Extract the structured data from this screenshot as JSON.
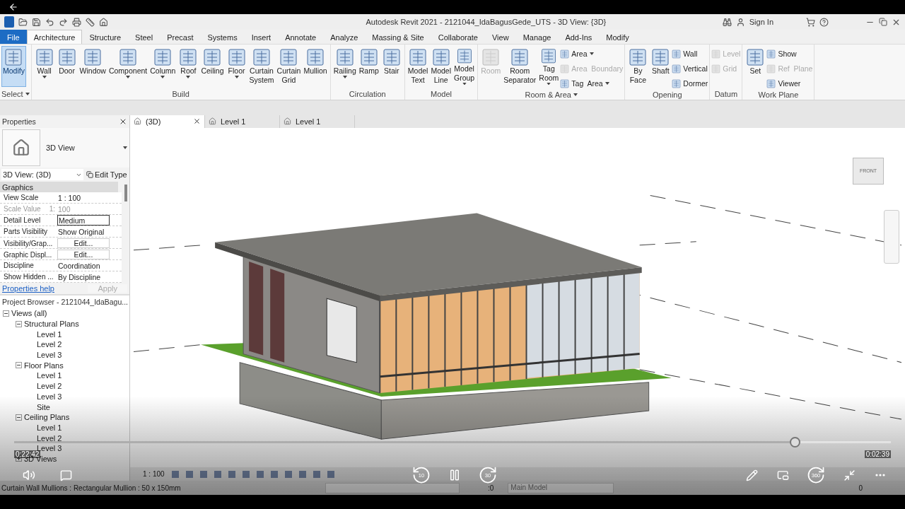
{
  "titlebar": {
    "title": "Autodesk Revit 2021 - 2121044_IdaBagusGede_UTS - 3D View: {3D}",
    "sign_in": "Sign In"
  },
  "menu_tabs": [
    {
      "label": "File",
      "kind": "file",
      "selected": false
    },
    {
      "label": "Architecture",
      "kind": "tab",
      "selected": true
    },
    {
      "label": "Structure",
      "kind": "tab",
      "selected": false
    },
    {
      "label": "Steel",
      "kind": "tab",
      "selected": false
    },
    {
      "label": "Precast",
      "kind": "tab",
      "selected": false
    },
    {
      "label": "Systems",
      "kind": "tab",
      "selected": false
    },
    {
      "label": "Insert",
      "kind": "tab",
      "selected": false
    },
    {
      "label": "Annotate",
      "kind": "tab",
      "selected": false
    },
    {
      "label": "Analyze",
      "kind": "tab",
      "selected": false
    },
    {
      "label": "Massing & Site",
      "kind": "tab",
      "selected": false
    },
    {
      "label": "Collaborate",
      "kind": "tab",
      "selected": false
    },
    {
      "label": "View",
      "kind": "tab",
      "selected": false
    },
    {
      "label": "Manage",
      "kind": "tab",
      "selected": false
    },
    {
      "label": "Add-Ins",
      "kind": "tab",
      "selected": false
    },
    {
      "label": "Modify",
      "kind": "tab",
      "selected": false
    }
  ],
  "ribbon": [
    {
      "label": "Select",
      "menu": true,
      "tools": [
        {
          "kind": "large",
          "label": "Modify",
          "active": true,
          "disabled": false,
          "dropdown": false
        }
      ]
    },
    {
      "label": "Build",
      "menu": false,
      "tools": [
        {
          "kind": "large",
          "label": "Wall",
          "active": false,
          "disabled": false,
          "dropdown": true
        },
        {
          "kind": "large",
          "label": "Door",
          "active": false,
          "disabled": false,
          "dropdown": false
        },
        {
          "kind": "large",
          "label": "Window",
          "active": false,
          "disabled": false,
          "dropdown": false
        },
        {
          "kind": "large",
          "label": "Component",
          "active": false,
          "disabled": false,
          "dropdown": true
        },
        {
          "kind": "large",
          "label": "Column",
          "active": false,
          "disabled": false,
          "dropdown": true
        },
        {
          "kind": "large",
          "label": "Roof",
          "active": false,
          "disabled": false,
          "dropdown": true
        },
        {
          "kind": "large",
          "label": "Ceiling",
          "active": false,
          "disabled": false,
          "dropdown": false
        },
        {
          "kind": "large",
          "label": "Floor",
          "active": false,
          "disabled": false,
          "dropdown": true
        },
        {
          "kind": "large",
          "label": "Curtain System",
          "active": false,
          "disabled": false,
          "dropdown": false
        },
        {
          "kind": "large",
          "label": "Curtain Grid",
          "active": false,
          "disabled": false,
          "dropdown": false
        },
        {
          "kind": "large",
          "label": "Mullion",
          "active": false,
          "disabled": false,
          "dropdown": false
        }
      ]
    },
    {
      "label": "Circulation",
      "menu": false,
      "tools": [
        {
          "kind": "large",
          "label": "Railing",
          "active": false,
          "disabled": false,
          "dropdown": true
        },
        {
          "kind": "large",
          "label": "Ramp",
          "active": false,
          "disabled": false,
          "dropdown": false
        },
        {
          "kind": "large",
          "label": "Stair",
          "active": false,
          "disabled": false,
          "dropdown": false
        }
      ]
    },
    {
      "label": "Model",
      "menu": false,
      "tools": [
        {
          "kind": "large",
          "label": "Model Text",
          "active": false,
          "disabled": false,
          "dropdown": false
        },
        {
          "kind": "large",
          "label": "Model Line",
          "active": false,
          "disabled": false,
          "dropdown": false
        },
        {
          "kind": "large",
          "label": "Model Group",
          "active": false,
          "disabled": false,
          "dropdown": true
        }
      ]
    },
    {
      "label": "Room & Area",
      "menu": true,
      "tools": [
        {
          "kind": "large",
          "label": "Room",
          "active": false,
          "disabled": true,
          "dropdown": false
        },
        {
          "kind": "large",
          "label": "Room Separator",
          "active": false,
          "disabled": false,
          "dropdown": false
        },
        {
          "kind": "large",
          "label": "Tag Room",
          "active": false,
          "disabled": false,
          "dropdown": true
        },
        {
          "kind": "small",
          "label": "Area",
          "active": false,
          "disabled": false,
          "dropdown": true
        },
        {
          "kind": "small",
          "label": "Area  Boundary",
          "active": false,
          "disabled": true,
          "dropdown": false
        },
        {
          "kind": "small",
          "label": "Tag  Area",
          "active": false,
          "disabled": false,
          "dropdown": true
        }
      ]
    },
    {
      "label": "Opening",
      "menu": false,
      "tools": [
        {
          "kind": "large",
          "label": "By Face",
          "active": false,
          "disabled": false,
          "dropdown": false
        },
        {
          "kind": "large",
          "label": "Shaft",
          "active": false,
          "disabled": false,
          "dropdown": false
        },
        {
          "kind": "small",
          "label": "Wall",
          "active": false,
          "disabled": false,
          "dropdown": false
        },
        {
          "kind": "small",
          "label": "Vertical",
          "active": false,
          "disabled": false,
          "dropdown": false
        },
        {
          "kind": "small",
          "label": "Dormer",
          "active": false,
          "disabled": false,
          "dropdown": false
        }
      ]
    },
    {
      "label": "Datum",
      "menu": false,
      "tools": [
        {
          "kind": "small",
          "label": "Level",
          "active": false,
          "disabled": true,
          "dropdown": false
        },
        {
          "kind": "small",
          "label": "Grid",
          "active": false,
          "disabled": true,
          "dropdown": false
        }
      ]
    },
    {
      "label": "Work Plane",
      "menu": false,
      "tools": [
        {
          "kind": "large",
          "label": "Set",
          "active": false,
          "disabled": false,
          "dropdown": false
        },
        {
          "kind": "small",
          "label": "Show",
          "active": false,
          "disabled": false,
          "dropdown": false
        },
        {
          "kind": "small",
          "label": "Ref  Plane",
          "active": false,
          "disabled": true,
          "dropdown": false
        },
        {
          "kind": "small",
          "label": "Viewer",
          "active": false,
          "disabled": false,
          "dropdown": false
        }
      ]
    }
  ],
  "properties": {
    "title": "Properties",
    "type_name": "3D View",
    "selector": "3D View: (3D)",
    "edit_type": "Edit Type",
    "section": "Graphics",
    "rows": [
      {
        "label": "View Scale",
        "value": "1 : 100",
        "kind": "text",
        "disabled": false
      },
      {
        "label": "Scale Value",
        "prefix": "1:",
        "value": "100",
        "kind": "text",
        "disabled": true
      },
      {
        "label": "Detail Level",
        "value": "Medium",
        "kind": "field",
        "disabled": false
      },
      {
        "label": "Parts Visibility",
        "value": "Show Original",
        "kind": "text",
        "disabled": false
      },
      {
        "label": "Visibility/Grap...",
        "value": "Edit...",
        "kind": "button",
        "disabled": false
      },
      {
        "label": "Graphic Displ...",
        "value": "Edit...",
        "kind": "button",
        "disabled": false
      },
      {
        "label": "Discipline",
        "value": "Coordination",
        "kind": "text",
        "disabled": false
      },
      {
        "label": "Show Hidden ...",
        "value": "By Discipline",
        "kind": "text",
        "disabled": false
      }
    ],
    "help": "Properties help",
    "apply": "Apply"
  },
  "project_browser": {
    "title": "Project Browser - 2121044_IdaBagu...",
    "tree": [
      {
        "label": "Views (all)",
        "expanded": true,
        "children": [
          {
            "label": "Structural Plans",
            "expanded": true,
            "children": [
              {
                "label": "Level 1"
              },
              {
                "label": "Level 2"
              },
              {
                "label": "Level 3"
              }
            ]
          },
          {
            "label": "Floor Plans",
            "expanded": true,
            "children": [
              {
                "label": "Level 1"
              },
              {
                "label": "Level 2"
              },
              {
                "label": "Level 3"
              },
              {
                "label": "Site"
              }
            ]
          },
          {
            "label": "Ceiling Plans",
            "expanded": true,
            "children": [
              {
                "label": "Level 1"
              },
              {
                "label": "Level 2"
              },
              {
                "label": "Level 3"
              }
            ]
          },
          {
            "label": "3D Views",
            "expanded": false
          }
        ]
      }
    ]
  },
  "view_tabs": [
    {
      "label": "(3D)",
      "selected": true
    },
    {
      "label": "Level 1",
      "selected": false
    },
    {
      "label": "Level 1",
      "selected": false
    }
  ],
  "view_cube": {
    "face": "FRONT"
  },
  "view_bar": {
    "scale": "1 : 100"
  },
  "status_bar": {
    "text": "Curtain Wall Mullions : Rectangular Mullion : 50 x 150mm",
    "selection_count": ":0",
    "workset": "Main Model",
    "filter_count": "0"
  },
  "video": {
    "elapsed": "0:22:42",
    "remaining": "0:02:39",
    "level": 0.89,
    "playing": true,
    "skip_back": "10",
    "skip_forward": "30",
    "vr": "360"
  }
}
